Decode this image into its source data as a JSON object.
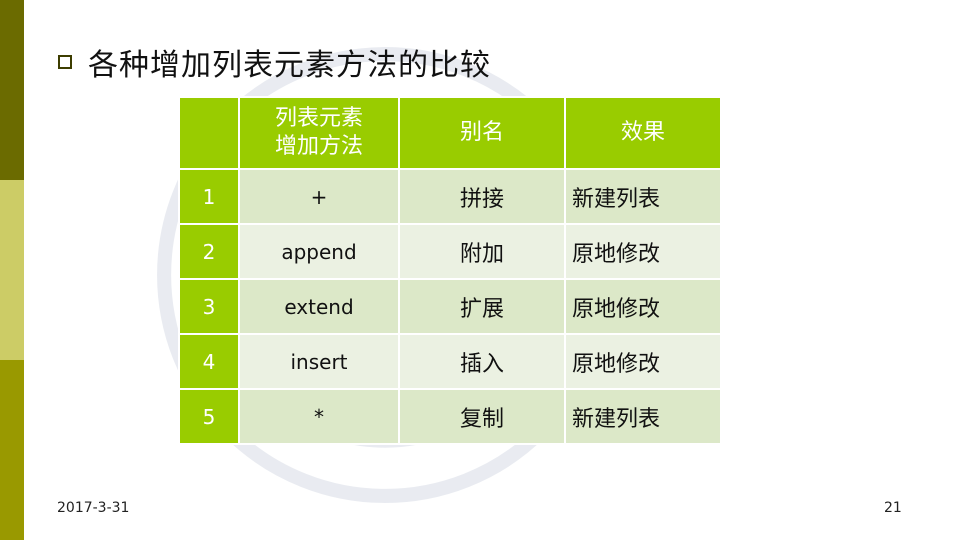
{
  "slide": {
    "title": "各种增加列表元素方法的比较",
    "date": "2017-3-31",
    "page_number": "21"
  },
  "table": {
    "headers": [
      "",
      "列表元素\n增加方法",
      "别名",
      "效果"
    ],
    "rows": [
      {
        "index": "1",
        "method": "+",
        "alias": "拼接",
        "effect": "新建列表"
      },
      {
        "index": "2",
        "method": "append",
        "alias": "附加",
        "effect": "原地修改"
      },
      {
        "index": "3",
        "method": "extend",
        "alias": "扩展",
        "effect": "原地修改"
      },
      {
        "index": "4",
        "method": "insert",
        "alias": "插入",
        "effect": "原地修改"
      },
      {
        "index": "5",
        "method": "*",
        "alias": "复制",
        "effect": "新建列表"
      }
    ]
  },
  "colors": {
    "header_green": "#99cc00",
    "row_odd": "#dce8c8",
    "row_even": "#ebf1e2",
    "sidebar_dark": "#6b6b00",
    "sidebar_light": "#cccc66",
    "sidebar_mid": "#999900"
  },
  "icons": {
    "bullet": "hollow-square-bullet-icon",
    "watermark": "university-seal-watermark"
  }
}
